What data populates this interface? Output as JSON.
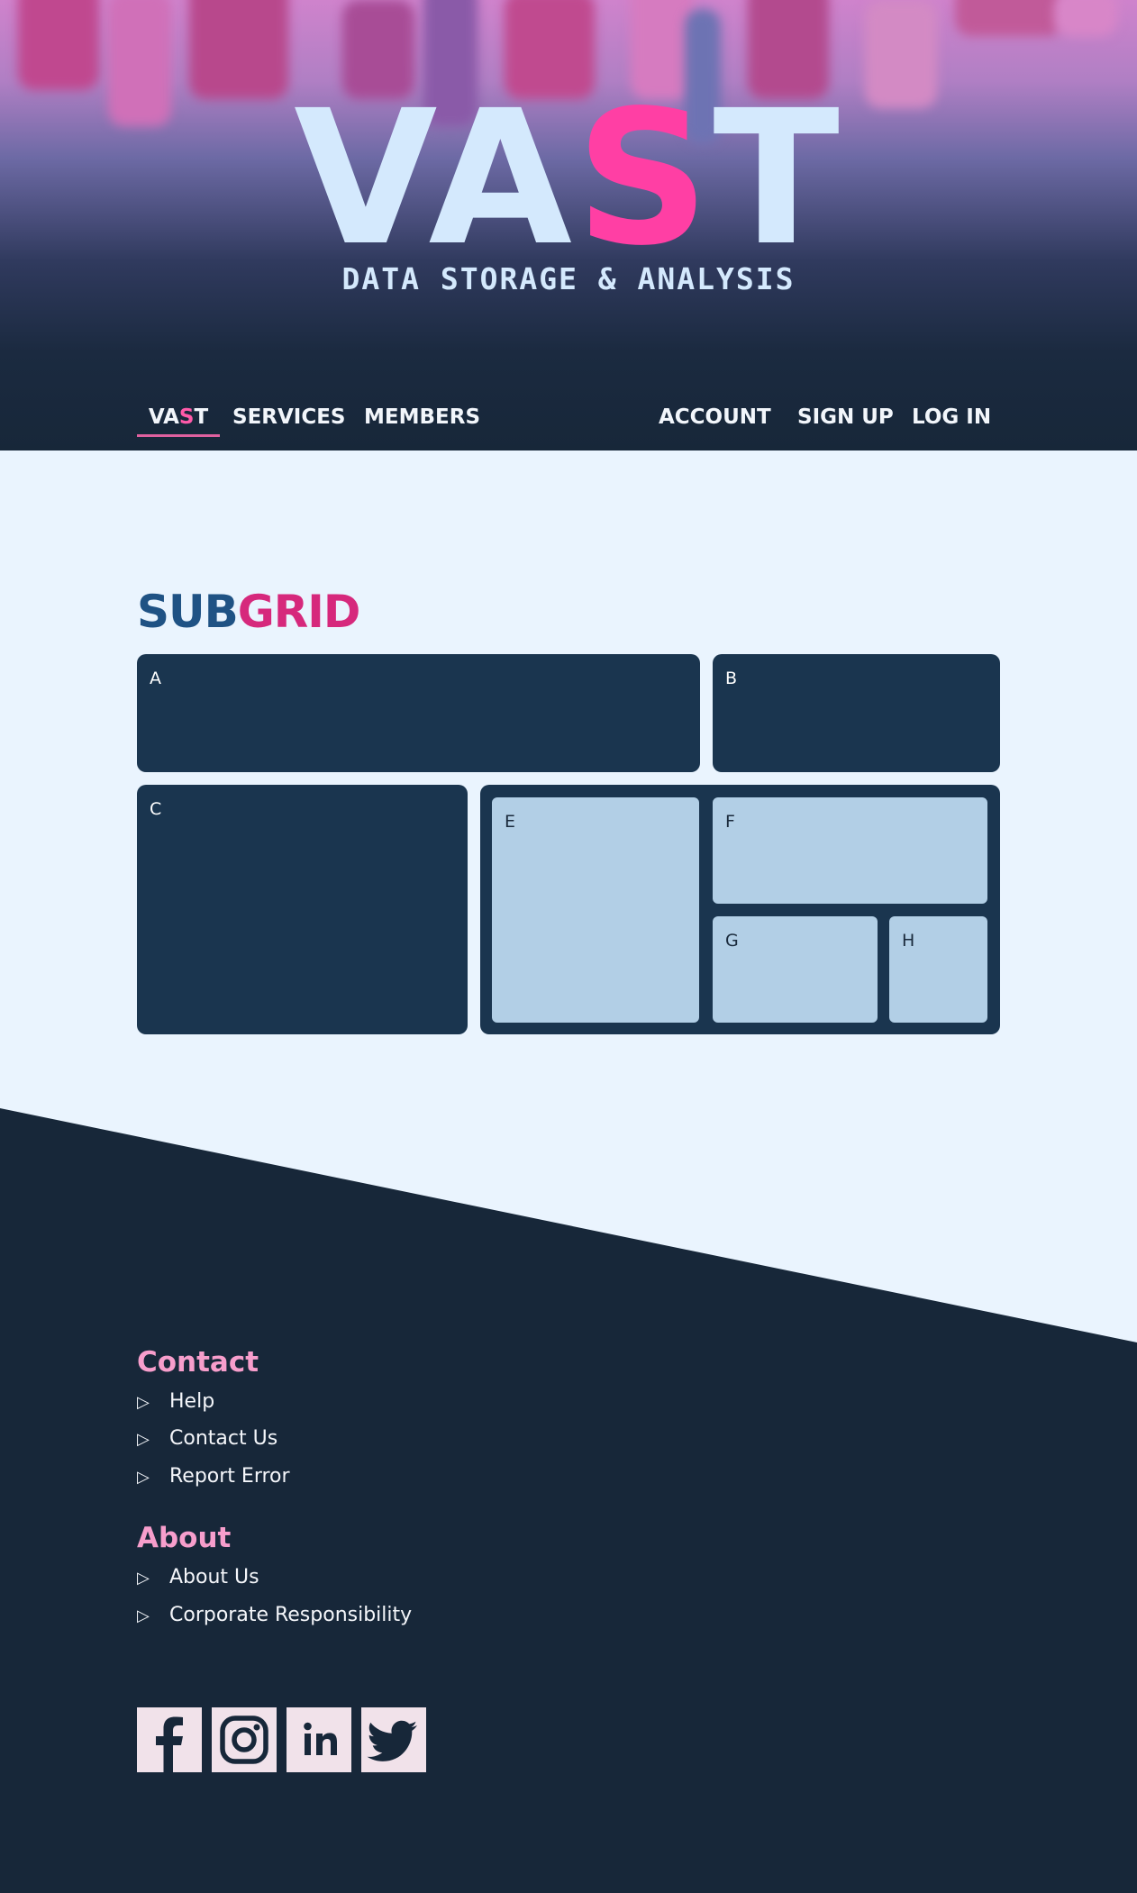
{
  "brand": {
    "part1": "VA",
    "accent": "S",
    "part2": "T",
    "tagline": "DATA STORAGE & ANALYSIS"
  },
  "nav": {
    "home": {
      "part1": "VA",
      "accent": "S",
      "part2": "T"
    },
    "left": [
      "SERVICES",
      "MEMBERS"
    ],
    "right": [
      "ACCOUNT",
      "SIGN UP",
      "LOG IN"
    ]
  },
  "main": {
    "title_part1": "SUB",
    "title_part2": "GRID",
    "cells": {
      "a": "A",
      "b": "B",
      "c": "C",
      "e": "E",
      "f": "F",
      "g": "G",
      "h": "H"
    }
  },
  "footer": {
    "contact": {
      "heading": "Contact",
      "links": [
        "Help",
        "Contact Us",
        "Report Error"
      ]
    },
    "about": {
      "heading": "About",
      "links": [
        "About Us",
        "Corporate Responsibility"
      ]
    },
    "link_marker": "▷",
    "social": [
      "facebook-icon",
      "instagram-icon",
      "linkedin-icon",
      "twitter-icon"
    ]
  },
  "colors": {
    "accent_pink": "#ff3fa4",
    "dark_navy": "#172739",
    "cell_dark": "#1a354f",
    "cell_light": "#b2cfe6",
    "page_bg": "#eaf4fe",
    "title_blue": "#1f5284",
    "heading_pink": "#f79ecc"
  }
}
